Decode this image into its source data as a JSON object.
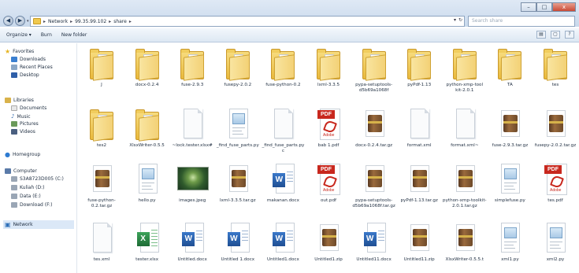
{
  "window": {
    "controls": [
      "–",
      "□",
      "x"
    ]
  },
  "address_bar": {
    "breadcrumbs": [
      "Network",
      "99.35.99.102",
      "share"
    ],
    "search_placeholder": "Search share"
  },
  "toolbar": {
    "organize": "Organize ▾",
    "burn": "Burn",
    "new_folder": "New folder"
  },
  "sidebar": {
    "favorites_header": "Favorites",
    "favorites": [
      "Downloads",
      "Recent Places",
      "Desktop"
    ],
    "libraries_header": "Libraries",
    "libraries": [
      "Documents",
      "Music",
      "Pictures",
      "Videos"
    ],
    "homegroup": "Homegroup",
    "computer_header": "Computer",
    "drives": [
      "S3A8723D005 (C:)",
      "Kuliah (D:)",
      "Data (E:)",
      "Download (F:)"
    ],
    "network": "Network"
  },
  "files": [
    {
      "name": "J",
      "type": "folder"
    },
    {
      "name": "docx-0.2.4",
      "type": "folder"
    },
    {
      "name": "fuse-2.9.3",
      "type": "folder"
    },
    {
      "name": "fusepy-2.0.2",
      "type": "folder"
    },
    {
      "name": "fuse-python-0.2",
      "type": "folder"
    },
    {
      "name": "lxml-3.3.5",
      "type": "folder"
    },
    {
      "name": "pypa-setuptools-d5b69a1068f",
      "type": "folder"
    },
    {
      "name": "pyPdf-1.13",
      "type": "folder"
    },
    {
      "name": "python-xmp-tool kit-2.0.1",
      "type": "folder"
    },
    {
      "name": "TA",
      "type": "folder"
    },
    {
      "name": "tes",
      "type": "folder"
    },
    {
      "name": "tes2",
      "type": "folder"
    },
    {
      "name": "XlsxWriter-0.5.5",
      "type": "folder"
    },
    {
      "name": "~lock.tester.xlsx#",
      "type": "doc"
    },
    {
      "name": "_find_fuse_parts.py",
      "type": "py"
    },
    {
      "name": "_find_fuse_parts.pyc",
      "type": "doc"
    },
    {
      "name": "bab 1.pdf",
      "type": "pdf"
    },
    {
      "name": "docx-0.2.4.tar.gz",
      "type": "archive"
    },
    {
      "name": "format.xml",
      "type": "doc"
    },
    {
      "name": "format.xml~",
      "type": "doc"
    },
    {
      "name": "fuse-2.9.3.tar.gz",
      "type": "archive"
    },
    {
      "name": "fusepy-2.0.2.tar.gz",
      "type": "archive"
    },
    {
      "name": "fuse-python-0.2.tar.gz",
      "type": "archive"
    },
    {
      "name": "hello.py",
      "type": "py"
    },
    {
      "name": "images.jpeg",
      "type": "image"
    },
    {
      "name": "lxml-3.3.5.tar.gz",
      "type": "archive"
    },
    {
      "name": "makanan.docx",
      "type": "word"
    },
    {
      "name": "out.pdf",
      "type": "pdf"
    },
    {
      "name": "pypa-setuptools-d5b69a1068f.tar.gz",
      "type": "archive"
    },
    {
      "name": "pyPdf-1.13.tar.gz",
      "type": "archive"
    },
    {
      "name": "python-xmp-toolkit-2.0.1.tar.gz",
      "type": "archive"
    },
    {
      "name": "simplefuse.py",
      "type": "py"
    },
    {
      "name": "tes.pdf",
      "type": "pdf"
    },
    {
      "name": "tes.xml",
      "type": "doc"
    },
    {
      "name": "tester.xlsx",
      "type": "excel"
    },
    {
      "name": "Untitled.docx",
      "type": "word"
    },
    {
      "name": "Untitled 1.docx",
      "type": "word"
    },
    {
      "name": "Untitled1.docx",
      "type": "word"
    },
    {
      "name": "Untitled1.zip",
      "type": "archive"
    },
    {
      "name": "Untitled11.docx",
      "type": "word"
    },
    {
      "name": "Untitled11.zip",
      "type": "archive"
    },
    {
      "name": "XlsxWriter-0.5.5.t",
      "type": "archive"
    },
    {
      "name": "xml1.py",
      "type": "py"
    },
    {
      "name": "xml2.py",
      "type": "py"
    }
  ]
}
